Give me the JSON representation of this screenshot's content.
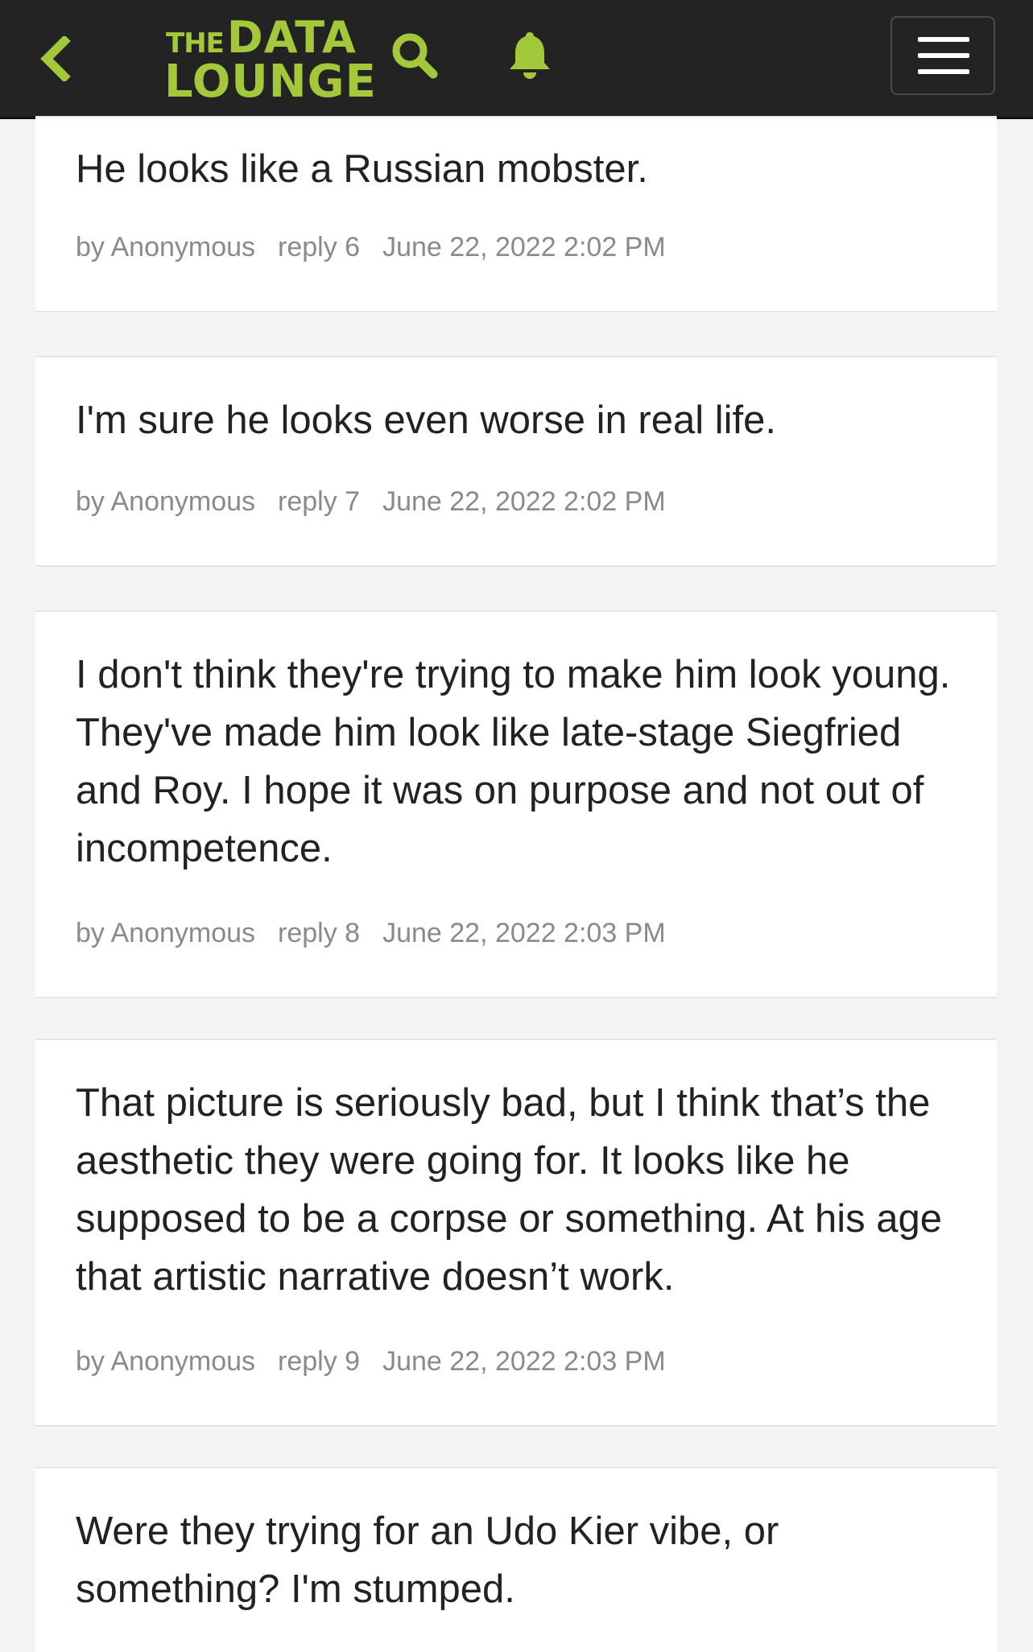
{
  "header": {
    "logo_line1_small": "THE",
    "logo_line1_large": "DATA",
    "logo_line2": "LOUNGE",
    "accent_color": "#a3c93a",
    "background_color": "#232323",
    "icons": [
      "chevron-left-icon",
      "search-icon",
      "bell-icon",
      "hamburger-menu-icon"
    ]
  },
  "posts": [
    {
      "text": "He looks like a Russian mobster.",
      "author": "by Anonymous",
      "reply": "reply 6",
      "timestamp": "June 22, 2022 2:02 PM"
    },
    {
      "text": "I'm sure he looks even worse in real life.",
      "author": "by Anonymous",
      "reply": "reply 7",
      "timestamp": "June 22, 2022 2:02 PM"
    },
    {
      "text": "I don't think they're trying to make him look young. They've made him look like late-stage Siegfried and Roy. I hope it was on purpose and not out of incompetence.",
      "author": "by Anonymous",
      "reply": "reply 8",
      "timestamp": "June 22, 2022 2:03 PM"
    },
    {
      "text": "That picture is seriously bad, but I think that’s the aesthetic they were going for. It looks like he supposed to be a corpse or something. At his age that artistic narrative doesn’t work.",
      "author": "by Anonymous",
      "reply": "reply 9",
      "timestamp": "June 22, 2022 2:03 PM"
    },
    {
      "text": "Were they trying for an Udo Kier vibe, or something? I'm stumped."
    }
  ]
}
